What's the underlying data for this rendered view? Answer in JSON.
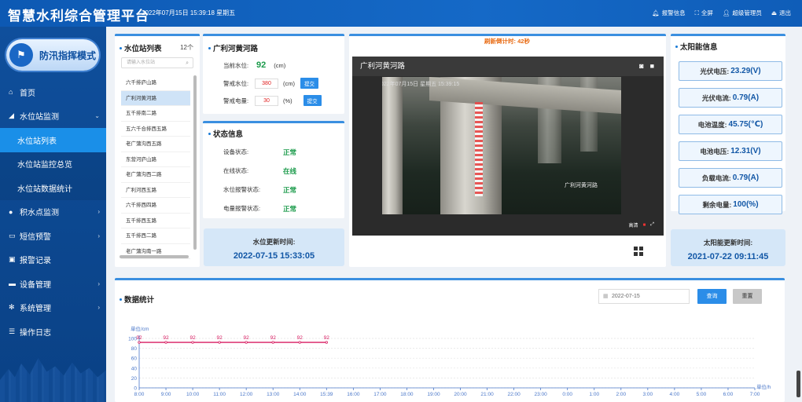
{
  "header": {
    "title": "智慧水利综合管理平台",
    "datetime": "2022年07月15日  15:39:18  星期五",
    "actions": [
      "报警信息",
      "全屏",
      "超级管理员",
      "退出"
    ]
  },
  "sidebar": {
    "mode_button": "防汛指挥模式",
    "items": [
      {
        "label": "首页"
      },
      {
        "label": "水位站监测"
      },
      {
        "label": "水位站列表"
      },
      {
        "label": "水位站监控总览"
      },
      {
        "label": "水位站数据统计"
      },
      {
        "label": "积水点监测"
      },
      {
        "label": "短信预警"
      },
      {
        "label": "报警记录"
      },
      {
        "label": "设备管理"
      },
      {
        "label": "系统管理"
      },
      {
        "label": "操作日志"
      }
    ]
  },
  "station_list": {
    "title": "水位站列表",
    "count": "12个",
    "search_placeholder": "请输入水位站",
    "items": [
      "六千排庐山路",
      "广利河黄河路",
      "五千排南二路",
      "五六千合排西五路",
      "老广蒲沟西五路",
      "东营河庐山路",
      "老广蒲沟西二路",
      "广利河西五路",
      "六千排西四路",
      "五千排西五路",
      "五千排西二路",
      "老广蒲沟南一路"
    ],
    "selected": "广利河黄河路"
  },
  "level_panel": {
    "title": "广利河黄河路",
    "current_label": "当前水位:",
    "current_value": "92",
    "current_unit": "(cm)",
    "warn_level_label": "警戒水位:",
    "warn_level_value": "380",
    "warn_level_unit": "(cm)",
    "warn_power_label": "警戒电量:",
    "warn_power_value": "30",
    "warn_power_unit": "(%)",
    "submit": "提交"
  },
  "status_panel": {
    "title": "状态信息",
    "rows": [
      {
        "label": "设备状态:",
        "value": "正常"
      },
      {
        "label": "在线状态:",
        "value": "在线"
      },
      {
        "label": "水位报警状态:",
        "value": "正常"
      },
      {
        "label": "电量报警状态:",
        "value": "正常"
      }
    ]
  },
  "water_update": {
    "label": "水位更新时间:",
    "value": "2022-07-15 15:33:05"
  },
  "video": {
    "countdown": "刷新倒计时:  42秒",
    "title": "广利河黄河路",
    "timestamp": "2022年07月15日  星期五  15:39:15",
    "location": "广利河黄河路",
    "quality": "高清"
  },
  "solar": {
    "title": "太阳能信息",
    "rows": [
      {
        "label": "光伏电压:",
        "value": "23.29(V)"
      },
      {
        "label": "光伏电流:",
        "value": "0.79(A)"
      },
      {
        "label": "电池温度:",
        "value": "45.75(℃)"
      },
      {
        "label": "电池电压:",
        "value": "12.31(V)"
      },
      {
        "label": "负载电流:",
        "value": "0.79(A)"
      },
      {
        "label": "剩余电量:",
        "value": "100(%)"
      }
    ],
    "update_label": "太阳能更新时间:",
    "update_value": "2021-07-22 09:11:45"
  },
  "stats": {
    "title": "数据统计",
    "date": "2022-07-15",
    "query": "查询",
    "reset": "重置"
  },
  "chart_data": {
    "type": "line",
    "ylabel": "单位/cm",
    "xlabel": "单位/h",
    "ylim": [
      0,
      100
    ],
    "yticks": [
      0,
      20,
      40,
      60,
      80,
      100
    ],
    "x": [
      "8:00",
      "9:00",
      "10:00",
      "11:00",
      "12:00",
      "13:00",
      "14:00",
      "15:39",
      "16:00",
      "17:00",
      "18:00",
      "19:00",
      "20:00",
      "21:00",
      "22:00",
      "23:00",
      "0:00",
      "1:00",
      "2:00",
      "3:00",
      "4:00",
      "5:00",
      "6:00",
      "7:00"
    ],
    "series": [
      {
        "values": [
          92,
          92,
          92,
          92,
          92,
          92,
          92,
          92
        ],
        "color": "#d81b60"
      }
    ]
  }
}
